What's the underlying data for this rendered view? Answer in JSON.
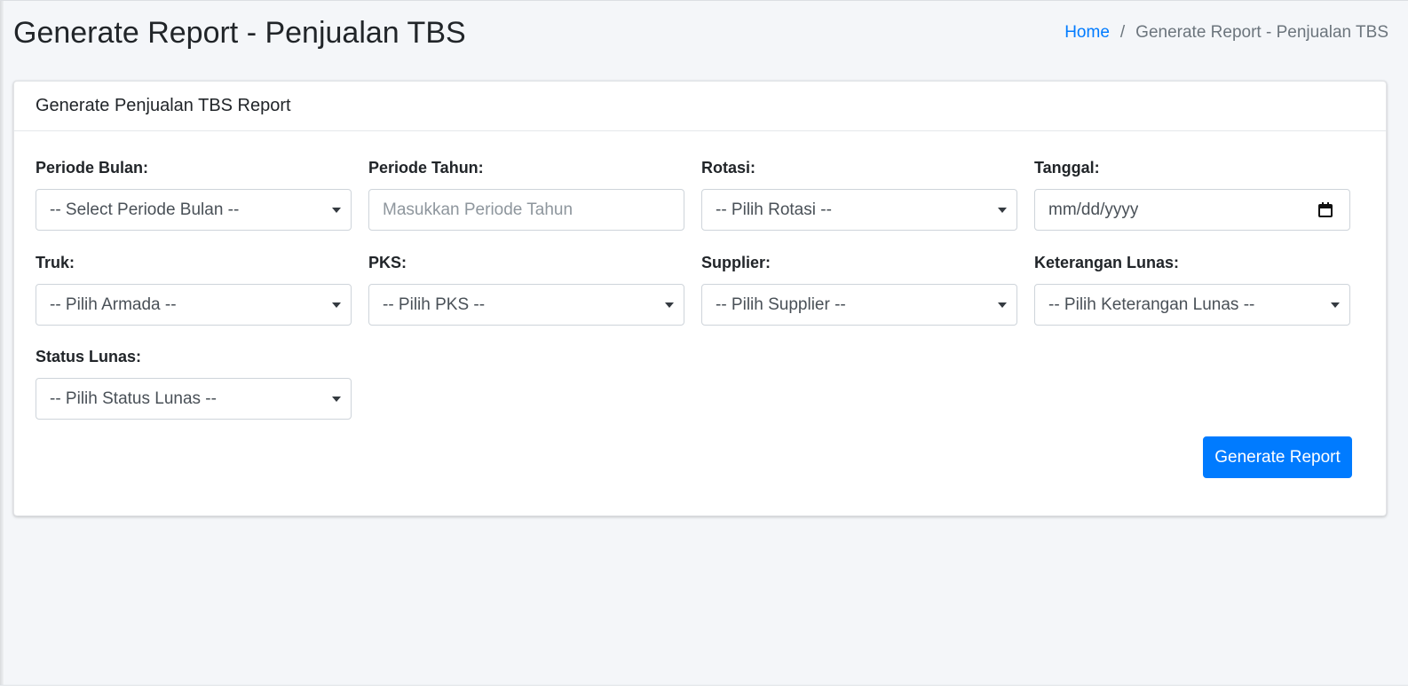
{
  "page": {
    "title": "Generate Report - Penjualan TBS"
  },
  "breadcrumb": {
    "home": "Home",
    "separator": "/",
    "current": "Generate Report - Penjualan TBS"
  },
  "card": {
    "title": "Generate Penjualan TBS Report"
  },
  "form": {
    "periode_bulan": {
      "label": "Periode Bulan:",
      "value": "-- Select Periode Bulan --"
    },
    "periode_tahun": {
      "label": "Periode Tahun:",
      "placeholder": "Masukkan Periode Tahun"
    },
    "rotasi": {
      "label": "Rotasi:",
      "value": "-- Pilih Rotasi --"
    },
    "tanggal": {
      "label": "Tanggal:",
      "value": "mm/dd/yyyy"
    },
    "truk": {
      "label": "Truk:",
      "value": "-- Pilih Armada --"
    },
    "pks": {
      "label": "PKS:",
      "value": "-- Pilih PKS --"
    },
    "supplier": {
      "label": "Supplier:",
      "value": "-- Pilih Supplier --"
    },
    "keterangan_lunas": {
      "label": "Keterangan Lunas:",
      "value": "-- Pilih Keterangan Lunas --"
    },
    "status_lunas": {
      "label": "Status Lunas:",
      "value": "-- Pilih Status Lunas --"
    }
  },
  "actions": {
    "generate_label": "Generate Report"
  },
  "colors": {
    "primary": "#007bff",
    "background": "#f4f6f9",
    "card": "#ffffff"
  },
  "icons": {
    "dropdown": "caret-down-icon",
    "date": "calendar-icon"
  }
}
